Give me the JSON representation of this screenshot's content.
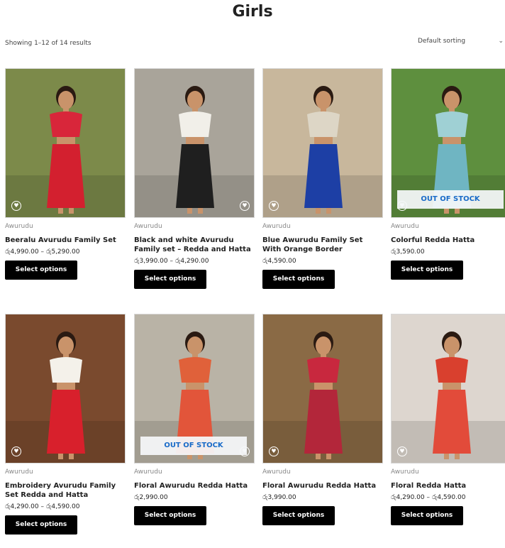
{
  "page": {
    "title": "Girls",
    "result_count": "Showing 1–12 of 14 results",
    "sorting": "Default sorting"
  },
  "products": [
    {
      "category": "Awurudu",
      "name": "Beeralu Avurudu Family Set",
      "price": "රු4,990.00 – රු5,290.00",
      "button": "Select options",
      "badge": "",
      "colors": {
        "bg": "#7c8a4a",
        "top": "#d8263a",
        "skirt": "#d3202f",
        "skin": "#c9936a"
      }
    },
    {
      "category": "Awurudu",
      "name": "Black and white Avurudu Family set – Redda and Hatta",
      "price": "රු3,990.00 – රු4,290.00",
      "button": "Select options",
      "badge": "",
      "colors": {
        "bg": "#a9a49a",
        "top": "#f1efe9",
        "skirt": "#1f1f1f",
        "skin": "#c9936a"
      }
    },
    {
      "category": "Awurudu",
      "name": "Blue Awurudu Family Set With Orange Border",
      "price": "රු4,590.00",
      "button": "Select options",
      "badge": "",
      "colors": {
        "bg": "#c8b79c",
        "top": "#ddd6c6",
        "skirt": "#1d3fa5",
        "skin": "#c9936a"
      }
    },
    {
      "category": "Awurudu",
      "name": "Colorful Redda Hatta",
      "price": "රු3,590.00",
      "button": "Select options",
      "badge": "OUT OF STOCK",
      "colors": {
        "bg": "#5e8f3e",
        "top": "#9fd0d4",
        "skirt": "#6fb5c2",
        "skin": "#c9936a"
      }
    },
    {
      "category": "Awurudu",
      "name": "Embroidery Avurudu Family Set Redda and Hatta",
      "price": "රු4,290.00 – රු4,590.00",
      "button": "Select options",
      "badge": "",
      "colors": {
        "bg": "#7a4a2e",
        "top": "#f4f1ea",
        "skirt": "#d8202c",
        "skin": "#c9936a"
      }
    },
    {
      "category": "Awurudu",
      "name": "Floral Awurudu Redda Hatta",
      "price": "රු2,990.00",
      "button": "Select options",
      "badge": "OUT OF STOCK",
      "colors": {
        "bg": "#b9b3a6",
        "top": "#e0613a",
        "skirt": "#e2553a",
        "skin": "#c9936a"
      }
    },
    {
      "category": "Awurudu",
      "name": "Floral Awurudu Redda Hatta",
      "price": "රු3,990.00",
      "button": "Select options",
      "badge": "",
      "colors": {
        "bg": "#8a6a45",
        "top": "#c8283e",
        "skirt": "#b3263a",
        "skin": "#c9936a"
      }
    },
    {
      "category": "Awurudu",
      "name": "Floral Redda Hatta",
      "price": "රු4,290.00 – රු4,590.00",
      "button": "Select options",
      "badge": "",
      "colors": {
        "bg": "#ddd6cf",
        "top": "#d9402e",
        "skirt": "#e24b3a",
        "skin": "#c9936a"
      }
    }
  ]
}
